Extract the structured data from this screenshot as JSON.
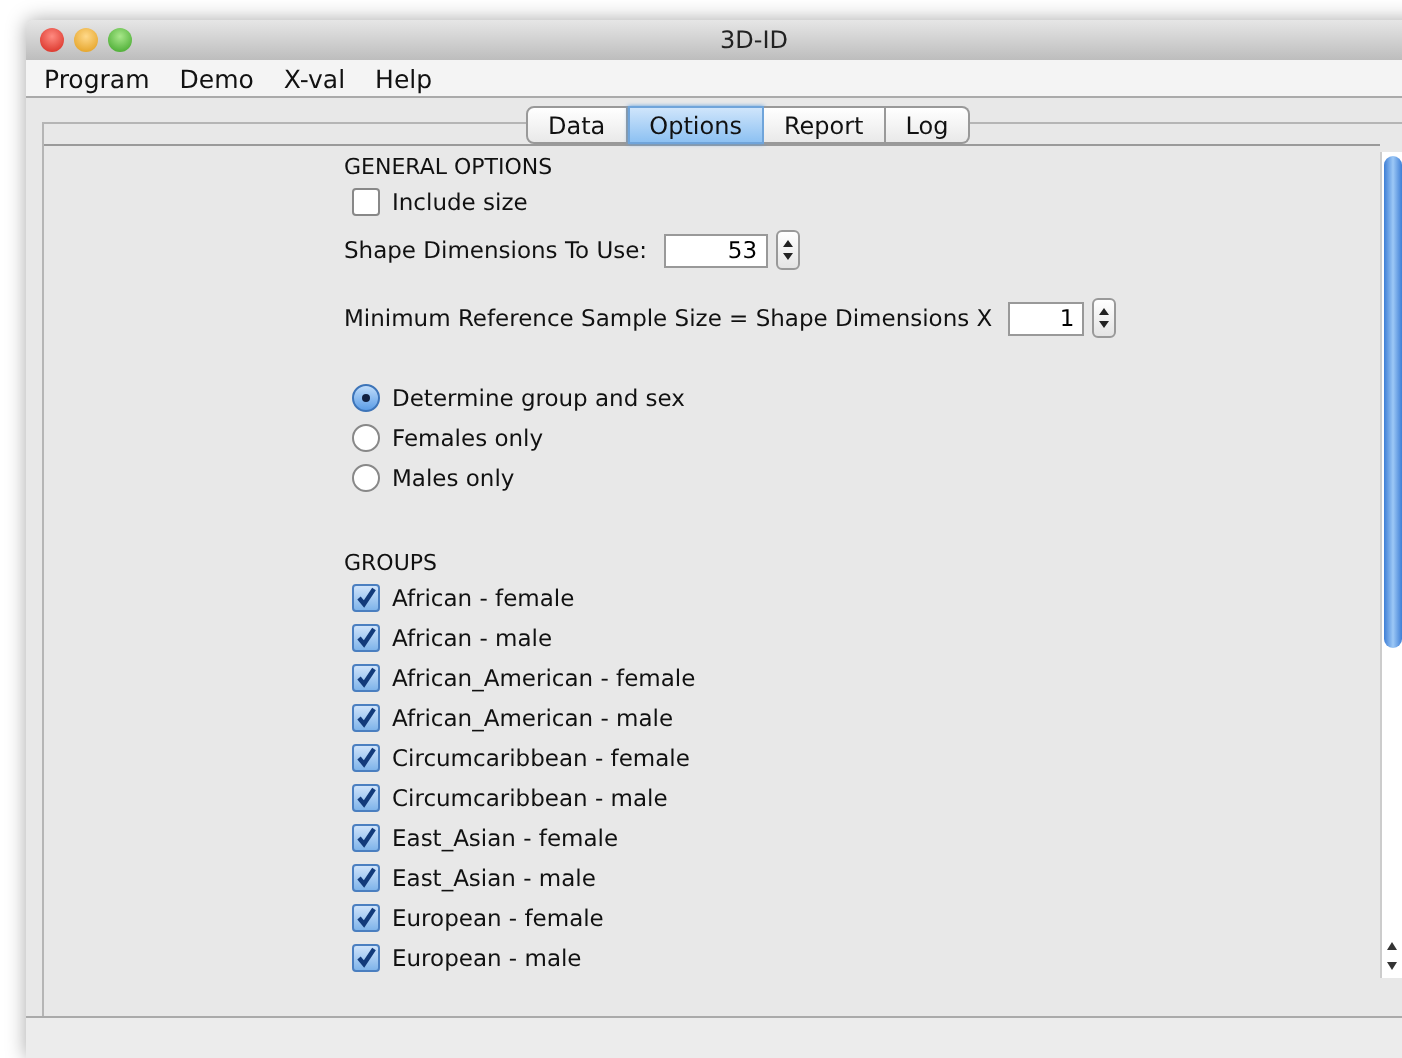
{
  "window": {
    "title": "3D-ID"
  },
  "menu": [
    "Program",
    "Demo",
    "X-val",
    "Help"
  ],
  "tabs": [
    {
      "label": "Data",
      "selected": false
    },
    {
      "label": "Options",
      "selected": true
    },
    {
      "label": "Report",
      "selected": false
    },
    {
      "label": "Log",
      "selected": false
    }
  ],
  "general_options": {
    "heading": "GENERAL OPTIONS",
    "include_size": {
      "label": "Include size",
      "checked": false
    },
    "shape_dimensions": {
      "label": "Shape Dimensions To Use:",
      "value": "53"
    },
    "min_reference": {
      "label": "Minimum Reference Sample Size = Shape Dimensions X",
      "value": "1"
    },
    "mode": [
      {
        "label": "Determine group and sex",
        "selected": true
      },
      {
        "label": "Females only",
        "selected": false
      },
      {
        "label": "Males only",
        "selected": false
      }
    ]
  },
  "groups": {
    "heading": "GROUPS",
    "items": [
      {
        "label": "African - female",
        "checked": true
      },
      {
        "label": "African - male",
        "checked": true
      },
      {
        "label": "African_American - female",
        "checked": true
      },
      {
        "label": "African_American - male",
        "checked": true
      },
      {
        "label": "Circumcaribbean - female",
        "checked": true
      },
      {
        "label": "Circumcaribbean - male",
        "checked": true
      },
      {
        "label": "East_Asian - female",
        "checked": true
      },
      {
        "label": "East_Asian - male",
        "checked": true
      },
      {
        "label": "European - female",
        "checked": true
      },
      {
        "label": "European - male",
        "checked": true
      }
    ]
  }
}
